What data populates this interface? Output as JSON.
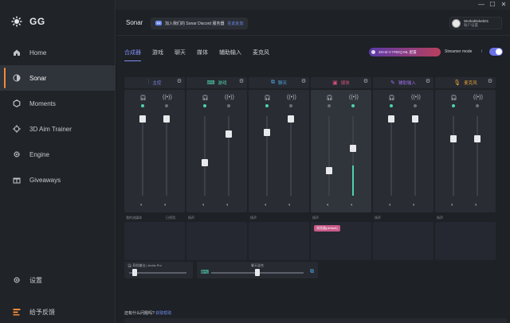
{
  "sidebar": {
    "logo_text": "GG",
    "items": [
      {
        "label": "Home",
        "icon": "home-icon"
      },
      {
        "label": "Sonar",
        "icon": "sonar-icon",
        "active": true
      },
      {
        "label": "Moments",
        "icon": "moments-icon"
      },
      {
        "label": "3D Aim Trainer",
        "icon": "crosshair-icon"
      },
      {
        "label": "Engine",
        "icon": "gear-icon"
      },
      {
        "label": "Giveaways",
        "icon": "gift-icon"
      }
    ],
    "settings_label": "设置",
    "feedback_label": "给予反馈"
  },
  "window_controls": {
    "minimize": "—",
    "maximize": "☐",
    "close": "✕"
  },
  "header": {
    "title": "Sonar",
    "discord_text": "加入我们的 Sonar Discord 服务器",
    "discord_link": "在此处加",
    "user_name": "Workablekeb01",
    "user_sub": "账户设置"
  },
  "tabs": [
    "合成器",
    "游戏",
    "聊天",
    "媒体",
    "辅助输入",
    "麦克风"
  ],
  "config_pill": "2KHZ-V FREQ-ML 配置",
  "streamer_mode_label": "Streamer mode",
  "streamer_mode_on": true,
  "channels": [
    {
      "name": "主控",
      "icon": "mixer-icon",
      "color": "#7e8cf2",
      "bottom_label": "我的流媒体",
      "bottom_label2": "已停用",
      "state": "enabled",
      "levels": {
        "monitor": 0.97,
        "stream": 0.97
      }
    },
    {
      "name": "游戏",
      "icon": "gamepad-icon",
      "color": "#4fd1b0",
      "bottom_label": "扬声",
      "state": "enabled",
      "levels": {
        "monitor": 0.42,
        "stream": 0.78
      }
    },
    {
      "name": "聊天",
      "icon": "chat-icon",
      "color": "#4fa8e8",
      "bottom_label": "扬声",
      "state": "enabled",
      "levels": {
        "monitor": 0.8,
        "stream": 0.97
      }
    },
    {
      "name": "媒体",
      "icon": "media-icon",
      "color": "#d0517a",
      "bottom_label": "扬声",
      "tag": "浏览器(default)",
      "state": "muted",
      "levels": {
        "monitor": 0.32,
        "stream": 0.6,
        "live": 0.38
      }
    },
    {
      "name": "辅助输入",
      "icon": "aux-icon",
      "color": "#9a6fea",
      "bottom_label": "扬声",
      "state": "enabled",
      "levels": {
        "monitor": 0.97,
        "stream": 0.97
      }
    },
    {
      "name": "麦克风",
      "icon": "mic-icon",
      "color": "#e6a23c",
      "bottom_label": "扬声",
      "state": "enabled",
      "levels": {
        "monitor": 0.72,
        "stream": 0.72
      }
    }
  ],
  "chatmix": {
    "label": "聊天混合",
    "left_label": "耳机输出",
    "left_device": "Arctis Pro",
    "value": 0.5
  },
  "footer_question": "还有什么问题吗?",
  "footer_link": "获取帮助"
}
